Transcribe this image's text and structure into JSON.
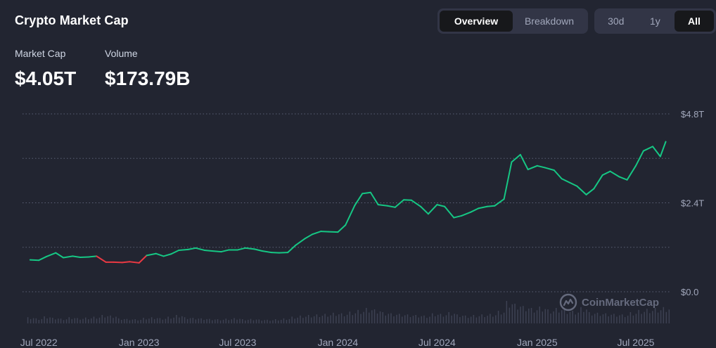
{
  "header": {
    "title": "Crypto Market Cap",
    "view_tabs": [
      {
        "label": "Overview",
        "active": true
      },
      {
        "label": "Breakdown",
        "active": false
      }
    ],
    "range_tabs": [
      {
        "label": "30d",
        "active": false
      },
      {
        "label": "1y",
        "active": false
      },
      {
        "label": "All",
        "active": true
      }
    ]
  },
  "metrics": {
    "market_cap_label": "Market Cap",
    "market_cap_value": "$4.05T",
    "volume_label": "Volume",
    "volume_value": "$173.79B"
  },
  "watermark": "CoinMarketCap",
  "colors": {
    "background": "#222531",
    "up": "#16c784",
    "down": "#ea3943",
    "grid": "#5b6075",
    "tick_text": "#a1a7bb",
    "volume": "#3d4152"
  },
  "chart_data": {
    "type": "line",
    "title": "",
    "xlabel": "",
    "ylabel": "",
    "x_unit": "date",
    "y_unit": "trillion USD",
    "ylim": [
      0,
      4.8
    ],
    "y_ticks": [
      {
        "value": 0,
        "label": "$0.0"
      },
      {
        "value": 2.4,
        "label": "$2.4T"
      },
      {
        "value": 4.8,
        "label": "$4.8T"
      }
    ],
    "gridlines_y": [
      0,
      1.2,
      2.4,
      3.6,
      4.8
    ],
    "x_range": [
      "2022-06-01",
      "2025-09-01"
    ],
    "x_ticks": [
      {
        "date": "2022-07-01",
        "label": "Jul 2022"
      },
      {
        "date": "2023-01-01",
        "label": "Jan 2023"
      },
      {
        "date": "2023-07-01",
        "label": "Jul 2023"
      },
      {
        "date": "2024-01-01",
        "label": "Jan 2024"
      },
      {
        "date": "2024-07-01",
        "label": "Jul 2024"
      },
      {
        "date": "2025-01-01",
        "label": "Jan 2025"
      },
      {
        "date": "2025-07-01",
        "label": "Jul 2025"
      }
    ],
    "grid": true,
    "legend": false,
    "series": [
      {
        "name": "",
        "x": [
          "2022-06-15",
          "2022-07-01",
          "2022-07-15",
          "2022-08-01",
          "2022-08-15",
          "2022-09-01",
          "2022-09-15",
          "2022-10-01",
          "2022-10-15",
          "2022-11-01",
          "2022-11-15",
          "2022-12-01",
          "2022-12-15",
          "2023-01-01",
          "2023-01-15",
          "2023-02-01",
          "2023-02-15",
          "2023-03-01",
          "2023-03-15",
          "2023-04-01",
          "2023-04-15",
          "2023-05-01",
          "2023-05-15",
          "2023-06-01",
          "2023-06-15",
          "2023-07-01",
          "2023-07-15",
          "2023-08-01",
          "2023-08-15",
          "2023-09-01",
          "2023-09-15",
          "2023-10-01",
          "2023-10-15",
          "2023-11-01",
          "2023-11-15",
          "2023-12-01",
          "2023-12-15",
          "2024-01-01",
          "2024-01-15",
          "2024-02-01",
          "2024-02-15",
          "2024-03-01",
          "2024-03-15",
          "2024-04-01",
          "2024-04-15",
          "2024-05-01",
          "2024-05-15",
          "2024-06-01",
          "2024-06-15",
          "2024-07-01",
          "2024-07-15",
          "2024-08-01",
          "2024-08-15",
          "2024-09-01",
          "2024-09-15",
          "2024-10-01",
          "2024-10-15",
          "2024-11-01",
          "2024-11-15",
          "2024-12-01",
          "2024-12-15",
          "2025-01-01",
          "2025-01-15",
          "2025-02-01",
          "2025-02-15",
          "2025-03-01",
          "2025-03-15",
          "2025-04-01",
          "2025-04-15",
          "2025-05-01",
          "2025-05-15",
          "2025-06-01",
          "2025-06-15",
          "2025-07-01",
          "2025-07-15",
          "2025-08-01",
          "2025-08-15",
          "2025-08-25"
        ],
        "values": [
          0.86,
          0.85,
          0.95,
          1.05,
          0.92,
          0.96,
          0.93,
          0.94,
          0.96,
          0.8,
          0.8,
          0.79,
          0.81,
          0.78,
          0.98,
          1.03,
          0.96,
          1.02,
          1.12,
          1.14,
          1.18,
          1.12,
          1.1,
          1.08,
          1.13,
          1.13,
          1.18,
          1.15,
          1.1,
          1.06,
          1.05,
          1.06,
          1.25,
          1.43,
          1.55,
          1.63,
          1.62,
          1.61,
          1.8,
          2.33,
          2.65,
          2.68,
          2.35,
          2.32,
          2.28,
          2.48,
          2.47,
          2.3,
          2.1,
          2.35,
          2.3,
          2.0,
          2.05,
          2.15,
          2.25,
          2.3,
          2.32,
          2.5,
          3.5,
          3.7,
          3.3,
          3.4,
          3.35,
          3.28,
          3.05,
          2.95,
          2.85,
          2.62,
          2.78,
          3.15,
          3.25,
          3.1,
          3.02,
          3.4,
          3.8,
          3.92,
          3.65,
          4.05
        ],
        "down_ranges": [
          [
            "2022-10-15",
            "2023-01-15"
          ]
        ]
      }
    ],
    "volume_note": "relative volume bars along bottom",
    "volume": {
      "x_start": "2022-06-15",
      "x_end": "2025-08-25",
      "values": [
        0.22,
        0.18,
        0.25,
        0.2,
        0.17,
        0.22,
        0.19,
        0.21,
        0.24,
        0.3,
        0.28,
        0.18,
        0.16,
        0.15,
        0.2,
        0.22,
        0.19,
        0.24,
        0.3,
        0.22,
        0.2,
        0.18,
        0.16,
        0.15,
        0.17,
        0.19,
        0.15,
        0.16,
        0.14,
        0.13,
        0.15,
        0.18,
        0.24,
        0.28,
        0.3,
        0.32,
        0.34,
        0.38,
        0.36,
        0.42,
        0.48,
        0.55,
        0.5,
        0.4,
        0.36,
        0.34,
        0.32,
        0.3,
        0.28,
        0.36,
        0.34,
        0.4,
        0.32,
        0.28,
        0.3,
        0.32,
        0.34,
        0.45,
        0.8,
        0.7,
        0.62,
        0.55,
        0.6,
        0.5,
        0.55,
        0.48,
        0.45,
        0.58,
        0.4,
        0.38,
        0.36,
        0.34,
        0.32,
        0.4,
        0.48,
        0.52,
        0.55,
        0.58
      ]
    }
  }
}
